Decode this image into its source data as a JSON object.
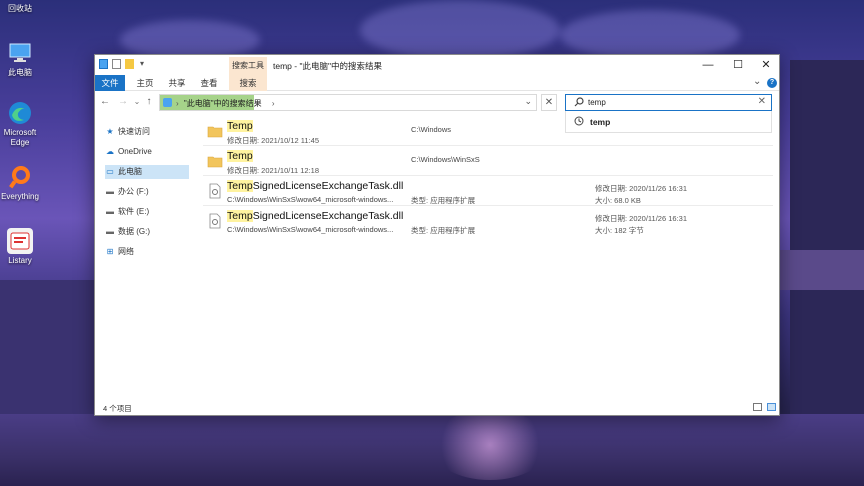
{
  "desktop": {
    "icons": [
      {
        "label": "回收站"
      },
      {
        "label": "此电脑"
      },
      {
        "label": "Microsoft Edge"
      },
      {
        "label": "Everything"
      },
      {
        "label": "Listary"
      }
    ]
  },
  "window": {
    "title": "temp - \"此电脑\"中的搜索结果",
    "context_tab": "搜索工具",
    "controls": {
      "minimize": "—",
      "maximize": "☐",
      "close": "✕"
    },
    "ribbon": {
      "tabs": [
        "文件",
        "主页",
        "共享",
        "查看",
        "搜索"
      ],
      "expand": "⌄",
      "help": "?"
    },
    "address": {
      "crumb": "\"此电脑\"中的搜索结果",
      "separator": "›",
      "trail": "›",
      "dropdown": "⌄",
      "clear": "✕"
    },
    "nav": {
      "back": "←",
      "forward": "→",
      "recent": "⌄",
      "up": "↑"
    },
    "search": {
      "value": "temp",
      "clear": "✕",
      "suggestion": "temp"
    },
    "sidebar": {
      "items": [
        {
          "icon": "star-icon",
          "label": "快速访问",
          "glyph": "★",
          "color": "#1a73c6"
        },
        {
          "icon": "cloud-icon",
          "label": "OneDrive",
          "glyph": "☁",
          "color": "#1a73c6"
        },
        {
          "icon": "computer-icon",
          "label": "此电脑",
          "glyph": "▭",
          "color": "#1a73c6"
        },
        {
          "icon": "drive-icon",
          "label": "办公 (F:)",
          "glyph": "▬",
          "color": "#666666"
        },
        {
          "icon": "drive-icon",
          "label": "软件 (E:)",
          "glyph": "▬",
          "color": "#666666"
        },
        {
          "icon": "drive-icon",
          "label": "数据 (G:)",
          "glyph": "▬",
          "color": "#666666"
        },
        {
          "icon": "network-icon",
          "label": "网络",
          "glyph": "⊞",
          "color": "#1a73c6"
        }
      ]
    },
    "results": [
      {
        "kind": "folder",
        "name_hl": "Temp",
        "name_rest": "",
        "meta": "修改日期: 2021/10/12 11:45",
        "location": "C:\\Windows",
        "type": "",
        "modified": "",
        "size": ""
      },
      {
        "kind": "folder",
        "name_hl": "Temp",
        "name_rest": "",
        "meta": "修改日期: 2021/10/11 12:18",
        "location": "C:\\Windows\\WinSxS",
        "type": "",
        "modified": "",
        "size": ""
      },
      {
        "kind": "file",
        "name_hl": "Temp",
        "name_rest": "SignedLicenseExchangeTask.dll",
        "meta": "C:\\Windows\\WinSxS\\wow64_microsoft-windows...",
        "location": "",
        "type": "类型: 应用程序扩展",
        "modified": "修改日期: 2020/11/26 16:31",
        "size": "大小: 68.0 KB"
      },
      {
        "kind": "file",
        "name_hl": "Temp",
        "name_rest": "SignedLicenseExchangeTask.dll",
        "meta": "C:\\Windows\\WinSxS\\wow64_microsoft-windows...",
        "location": "",
        "type": "类型: 应用程序扩展",
        "modified": "修改日期: 2020/11/26 16:31",
        "size": "大小: 182 字节"
      }
    ],
    "status": {
      "count": "4 个项目"
    }
  }
}
